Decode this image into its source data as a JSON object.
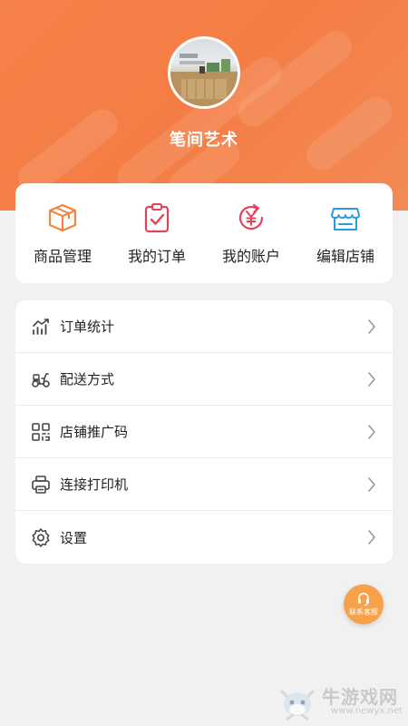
{
  "header": {
    "shop_name": "笔间艺术"
  },
  "quick_actions": [
    {
      "label": "商品管理",
      "icon": "box-icon",
      "color": "#f0863f"
    },
    {
      "label": "我的订单",
      "icon": "clipboard-check-icon",
      "color": "#e3435a"
    },
    {
      "label": "我的账户",
      "icon": "yuan-refresh-icon",
      "color": "#e3435a"
    },
    {
      "label": "编辑店铺",
      "icon": "store-icon",
      "color": "#2a9be0"
    }
  ],
  "menu": [
    {
      "label": "订单统计",
      "icon": "chart-icon"
    },
    {
      "label": "配送方式",
      "icon": "scooter-icon"
    },
    {
      "label": "店铺推广码",
      "icon": "qrcode-icon"
    },
    {
      "label": "连接打印机",
      "icon": "printer-icon"
    },
    {
      "label": "设置",
      "icon": "gear-icon"
    }
  ],
  "service_button": {
    "label": "联系客服"
  },
  "watermark": {
    "title": "牛游戏网",
    "url": "www.newyx.net"
  }
}
